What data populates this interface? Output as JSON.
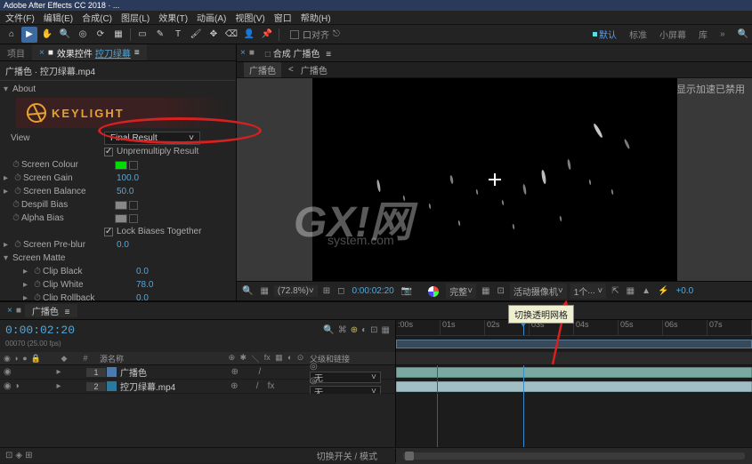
{
  "titlebar": "Adobe After Effects CC 2018 · ...",
  "menu": {
    "file": "文件(F)",
    "edit": "编辑(E)",
    "composition": "合成(C)",
    "layer": "图层(L)",
    "effect": "效果(T)",
    "animation": "动画(A)",
    "view": "视图(V)",
    "window": "窗口",
    "help": "帮助(H)"
  },
  "toolbar": {
    "snap": "口对齐",
    "ws_default": "默认",
    "ws_standard": "标准",
    "ws_small": "小屏幕",
    "ws_lib": "库"
  },
  "panelTabs": {
    "project": "项目",
    "effectControls": "效果控件",
    "effectTarget": "控刀绿幕"
  },
  "effectHeader": "广播色 · 控刀绿幕.mp4",
  "keylight": {
    "about": "About",
    "logo": "KEYLIGHT",
    "view": "View",
    "viewValue": "Final Result",
    "unpremult": "Unpremultiply Result",
    "screenColour": "Screen Colour",
    "screenGain": "Screen Gain",
    "screenGainVal": "100.0",
    "screenBalance": "Screen Balance",
    "screenBalanceVal": "50.0",
    "despill": "Despill Bias",
    "alphaBias": "Alpha Bias",
    "lockBiases": "Lock Biases Together",
    "preblur": "Screen Pre-blur",
    "preblurVal": "0.0",
    "screenMatte": "Screen Matte",
    "clipBlack": "Clip Black",
    "clipBlackVal": "0.0",
    "clipWhite": "Clip White",
    "clipWhiteVal": "78.0",
    "clipRollback": "Clip Rollback",
    "clipRollbackVal": "0.0"
  },
  "comp": {
    "panelPrefix": "合成",
    "name": "广播色",
    "crumb1": "广播色",
    "crumb2": "广播色"
  },
  "viewer": {
    "gpu": "显示加速已禁用",
    "zoom": "(72.8%)",
    "time": "0:00:02:20",
    "res": "完整",
    "camera": "活动摄像机",
    "viewCount": "1个",
    "exposure": "+0.0"
  },
  "tooltip": "切换透明网格",
  "watermark": {
    "main": "GX!网",
    "sub": "system.com"
  },
  "timeline": {
    "tab": "广播色",
    "timecode": "0:00:02:20",
    "framecode": "00070 (25.00 fps)",
    "searchLabel": "源名称",
    "parentLabel": "父级和链接",
    "parentNone": "无",
    "switchMode": "切换开关 / 模式",
    "ruler": [
      ":00s",
      "01s",
      "02s",
      "03s",
      "04s",
      "05s",
      "06s",
      "07s"
    ],
    "layers": [
      {
        "num": "1",
        "name": "广播色",
        "color": "#c7b85a"
      },
      {
        "num": "2",
        "name": "控刀绿幕.mp4",
        "color": "#5ac3c7"
      }
    ]
  }
}
